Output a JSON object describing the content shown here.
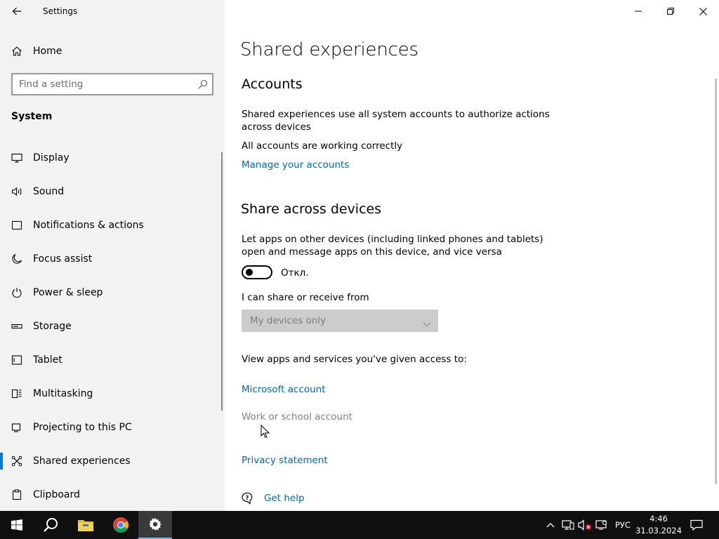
{
  "window": {
    "title": "Settings",
    "back_icon": "back-arrow-icon",
    "controls": [
      "minimize-icon",
      "restore-icon",
      "close-icon"
    ]
  },
  "sidebar": {
    "home_label": "Home",
    "search_placeholder": "Find a setting",
    "section_label": "System",
    "items": [
      {
        "label": "Display",
        "icon": "monitor-icon"
      },
      {
        "label": "Sound",
        "icon": "speaker-icon"
      },
      {
        "label": "Notifications & actions",
        "icon": "notification-icon"
      },
      {
        "label": "Focus assist",
        "icon": "moon-icon"
      },
      {
        "label": "Power & sleep",
        "icon": "power-icon"
      },
      {
        "label": "Storage",
        "icon": "storage-icon"
      },
      {
        "label": "Tablet",
        "icon": "tablet-icon"
      },
      {
        "label": "Multitasking",
        "icon": "multitasking-icon"
      },
      {
        "label": "Projecting to this PC",
        "icon": "projecting-icon"
      },
      {
        "label": "Shared experiences",
        "icon": "shared-experiences-icon",
        "selected": true
      },
      {
        "label": "Clipboard",
        "icon": "clipboard-icon"
      }
    ]
  },
  "main": {
    "title": "Shared experiences",
    "accounts": {
      "heading": "Accounts",
      "description": "Shared experiences use all system accounts to authorize actions across devices",
      "status": "All accounts are working correctly",
      "manage_link": "Manage your accounts"
    },
    "share": {
      "heading": "Share across devices",
      "description": "Let apps on other devices (including linked phones and tablets) open and message apps on this device, and vice versa",
      "toggle_state": "Откл.",
      "toggle_on": false,
      "share_from_label": "I can share or receive from",
      "share_from_value": "My devices only",
      "share_from_disabled": true
    },
    "access": {
      "label": "View apps and services you've given access to:",
      "microsoft_account": "Microsoft account",
      "work_account": "Work or school account"
    },
    "privacy_link": "Privacy statement",
    "help_link": "Get help"
  },
  "taskbar": {
    "apps": [
      "windows-start-icon",
      "search-icon",
      "file-explorer-icon",
      "chrome-icon",
      "settings-icon"
    ],
    "active_app": "settings-icon",
    "language": "РУС",
    "time": "4:46",
    "date": "31.03.2024"
  },
  "colors": {
    "accent": "#0078d7",
    "link": "#0067b8",
    "sidebar_bg": "#f2f2f2",
    "taskbar_bg": "#101010"
  }
}
